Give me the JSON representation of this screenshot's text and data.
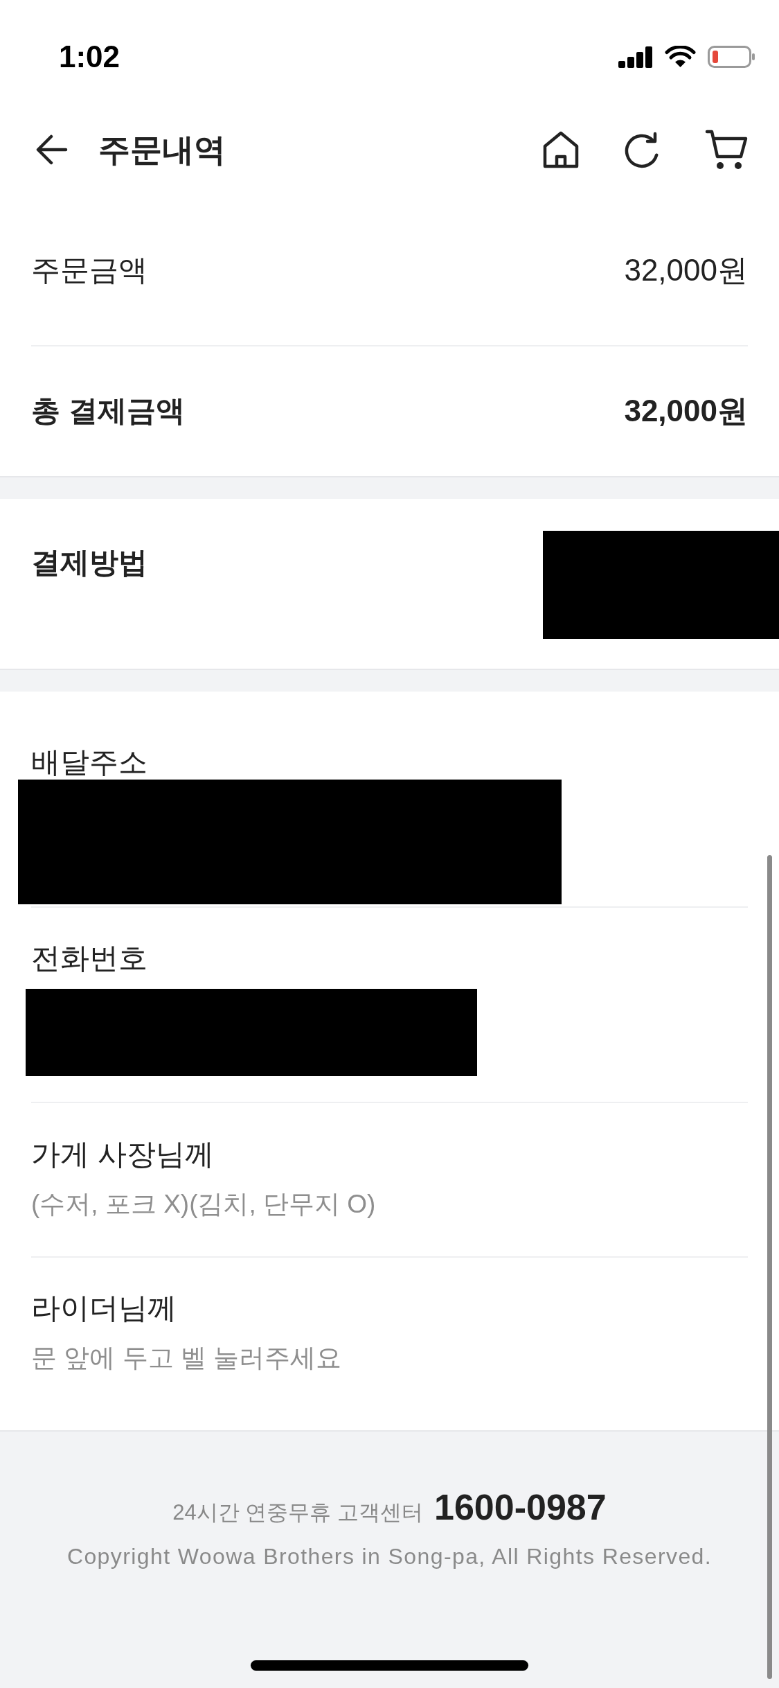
{
  "status_bar": {
    "time": "1:02"
  },
  "header": {
    "title": "주문내역"
  },
  "payment_summary": {
    "rows": [
      {
        "kind": "regular",
        "label": "주문금액",
        "value": "32,000원"
      },
      {
        "kind": "total",
        "label": "총 결제금액",
        "value": "32,000원"
      }
    ]
  },
  "payment_method": {
    "label": "결제방법",
    "redacted": true
  },
  "delivery_info": [
    {
      "label": "배달주소",
      "redacted": true
    },
    {
      "label": "전화번호",
      "redacted": true
    },
    {
      "label": "가게 사장님께",
      "value": "(수저, 포크 X)(김치, 단무지 O)"
    },
    {
      "label": "라이더님께",
      "value": "문 앞에 두고 벨 눌러주세요"
    }
  ],
  "footer": {
    "support_label": "24시간 연중무휴 고객센터",
    "support_phone": "1600-0987",
    "copyright": "Copyright Woowa Brothers in Song-pa, All Rights Reserved."
  }
}
